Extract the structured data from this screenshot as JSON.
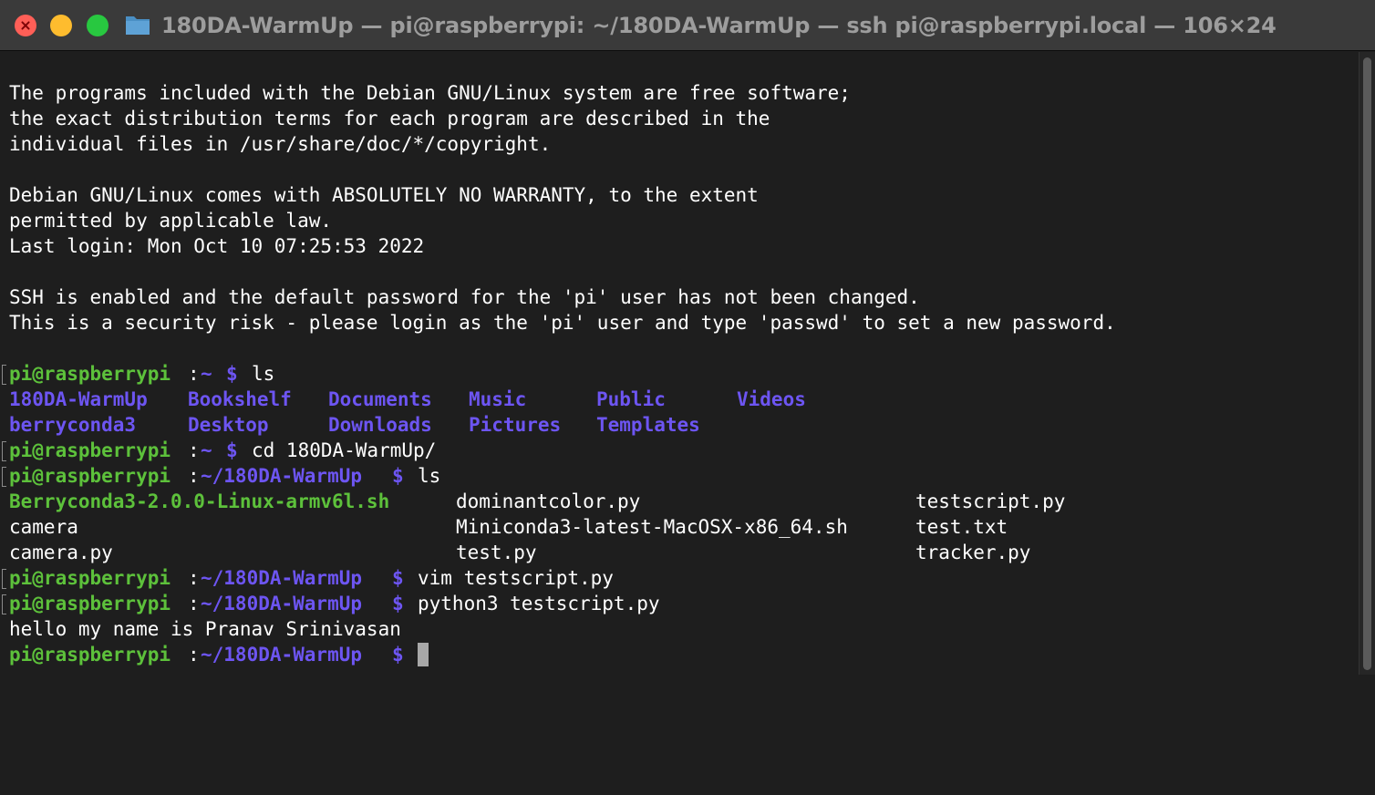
{
  "window": {
    "title": "180DA-WarmUp — pi@raspberrypi: ~/180DA-WarmUp — ssh pi@raspberrypi.local — 106×24",
    "folder_icon": "folder-icon",
    "traffic_lights": {
      "close": "#ff5f57",
      "minimize": "#febc2e",
      "zoom": "#28c840"
    }
  },
  "colors": {
    "background": "#1e1e1e",
    "text": "#ffffff",
    "prompt_user": "#5dc13b",
    "prompt_path": "#6d55f2",
    "directory": "#6d55f2",
    "executable": "#5dc13b"
  },
  "motd": {
    "line1": "The programs included with the Debian GNU/Linux system are free software;",
    "line2": "the exact distribution terms for each program are described in the",
    "line3": "individual files in /usr/share/doc/*/copyright.",
    "line4": "Debian GNU/Linux comes with ABSOLUTELY NO WARRANTY, to the extent",
    "line5": "permitted by applicable law.",
    "last_login": "Last login: Mon Oct 10 07:25:53 2022",
    "ssh_warning1": "SSH is enabled and the default password for the 'pi' user has not been changed.",
    "ssh_warning2": "This is a security risk - please login as the 'pi' user and type 'passwd' to set a new password."
  },
  "prompt": {
    "user": "pi@raspberrypi",
    "colon": ":",
    "home": "~",
    "warmup": "~/180DA-WarmUp",
    "dollar": "$"
  },
  "commands": {
    "ls_home": "ls",
    "cd": "cd 180DA-WarmUp/",
    "ls_warmup": "ls",
    "vim": "vim testscript.py",
    "python": "python3 testscript.py"
  },
  "home_listing": {
    "row1": [
      "180DA-WarmUp",
      "Bookshelf",
      "Documents",
      "Music",
      "Public",
      "Videos"
    ],
    "row2": [
      "berryconda3",
      "Desktop",
      "Downloads",
      "Pictures",
      "Templates"
    ]
  },
  "warmup_listing": {
    "row1": [
      "Berryconda3-2.0.0-Linux-armv6l.sh",
      "dominantcolor.py",
      "testscript.py"
    ],
    "row2": [
      "camera",
      "Miniconda3-latest-MacOSX-x86_64.sh",
      "test.txt"
    ],
    "row3": [
      "camera.py",
      "test.py",
      "tracker.py"
    ]
  },
  "output": {
    "hello": "hello my name is Pranav Srinivasan"
  }
}
